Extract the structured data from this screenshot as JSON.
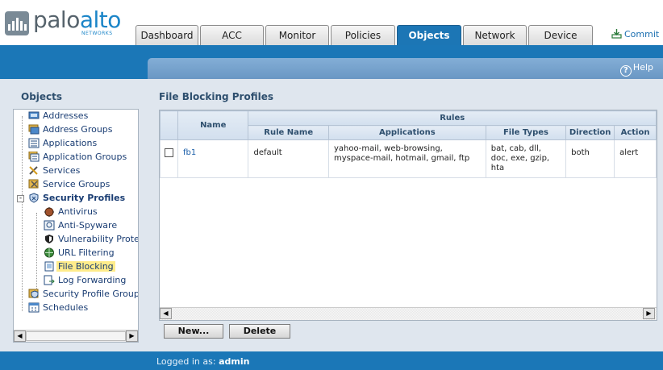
{
  "brand": {
    "name_part1": "palo",
    "name_part2": "alto",
    "sub": "NETWORKS"
  },
  "tabs": [
    {
      "label": "Dashboard",
      "active": false
    },
    {
      "label": "ACC",
      "active": false
    },
    {
      "label": "Monitor",
      "active": false
    },
    {
      "label": "Policies",
      "active": false
    },
    {
      "label": "Objects",
      "active": true
    },
    {
      "label": "Network",
      "active": false
    },
    {
      "label": "Device",
      "active": false
    }
  ],
  "commit_label": "Commit",
  "help_label": "Help",
  "sidebar": {
    "title": "Objects",
    "items": [
      {
        "label": "Addresses",
        "icon": "address-icon"
      },
      {
        "label": "Address Groups",
        "icon": "address-group-icon"
      },
      {
        "label": "Applications",
        "icon": "applications-icon"
      },
      {
        "label": "Application Groups",
        "icon": "application-groups-icon"
      },
      {
        "label": "Services",
        "icon": "services-icon"
      },
      {
        "label": "Service Groups",
        "icon": "service-groups-icon"
      },
      {
        "label": "Security Profiles",
        "icon": "security-profiles-icon"
      },
      {
        "label": "Antivirus",
        "icon": "antivirus-icon"
      },
      {
        "label": "Anti-Spyware",
        "icon": "anti-spyware-icon"
      },
      {
        "label": "Vulnerability Protection",
        "icon": "vulnerability-icon"
      },
      {
        "label": "URL Filtering",
        "icon": "url-filtering-icon"
      },
      {
        "label": "File Blocking",
        "icon": "file-blocking-icon",
        "selected": true
      },
      {
        "label": "Log Forwarding",
        "icon": "log-forwarding-icon"
      },
      {
        "label": "Security Profile Groups",
        "icon": "security-profile-groups-icon"
      },
      {
        "label": "Schedules",
        "icon": "schedules-icon"
      }
    ]
  },
  "main": {
    "title": "File Blocking Profiles",
    "table": {
      "group_header": "Rules",
      "headers": {
        "name": "Name",
        "rule_name": "Rule Name",
        "applications": "Applications",
        "file_types": "File Types",
        "direction": "Direction",
        "action": "Action"
      },
      "rows": [
        {
          "name": "fb1",
          "rule_name": "default",
          "applications": "yahoo-mail, web-browsing, myspace-mail, hotmail, gmail, ftp",
          "file_types": "bat, cab, dll, doc, exe, gzip, hta",
          "direction": "both",
          "action": "alert"
        }
      ]
    },
    "buttons": {
      "new": "New...",
      "delete": "Delete"
    }
  },
  "footer": {
    "logged_in_label": "Logged in as:",
    "user": "admin"
  },
  "colors": {
    "accent": "#1b77b7",
    "panel": "#dfe6ee",
    "selected": "#ffec8b"
  }
}
